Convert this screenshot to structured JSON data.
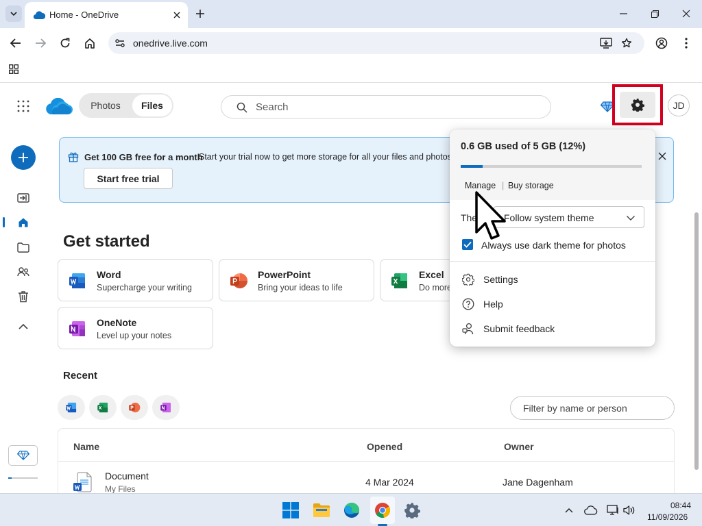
{
  "browser": {
    "tab_title": "Home - OneDrive",
    "url": "onedrive.live.com"
  },
  "header": {
    "pivot_photos": "Photos",
    "pivot_files": "Files",
    "search_placeholder": "Search",
    "avatar_initials": "JD"
  },
  "promo": {
    "title": "Get 100 GB free for a month",
    "text": "Start your trial now to get more storage for all your files and photos.",
    "button": "Start free trial"
  },
  "get_started": {
    "title": "Get started",
    "cards": [
      {
        "title": "Word",
        "subtitle": "Supercharge your writing"
      },
      {
        "title": "PowerPoint",
        "subtitle": "Bring your ideas to life"
      },
      {
        "title": "Excel",
        "subtitle": "Do more"
      },
      {
        "title": "OneNote",
        "subtitle": "Level up your notes"
      }
    ]
  },
  "recent": {
    "title": "Recent",
    "filter_placeholder": "Filter by name or person",
    "columns": [
      "Name",
      "Opened",
      "Owner"
    ],
    "rows": [
      {
        "name": "Document",
        "location": "My Files",
        "opened": "4 Mar 2024",
        "owner": "Jane Dagenham"
      }
    ]
  },
  "settings_popup": {
    "storage_text": "0.6 GB used of 5 GB (12%)",
    "storage_fraction": 0.12,
    "manage": "Manage",
    "separator": "|",
    "buy_storage": "Buy storage",
    "theme_label": "The",
    "theme_value": "Follow system theme",
    "dark_photos_label": "Always use dark theme for photos",
    "dark_photos_checked": true,
    "menu": [
      {
        "label": "Settings",
        "icon": "gear-icon"
      },
      {
        "label": "Help",
        "icon": "help-icon"
      },
      {
        "label": "Submit feedback",
        "icon": "feedback-icon"
      }
    ]
  },
  "taskbar": {
    "time": "08:44",
    "date": "11/09/2026"
  },
  "colors": {
    "accent": "#0f6cbd",
    "highlight_box": "#d1001f",
    "promo_bg": "#e5f1fb"
  }
}
